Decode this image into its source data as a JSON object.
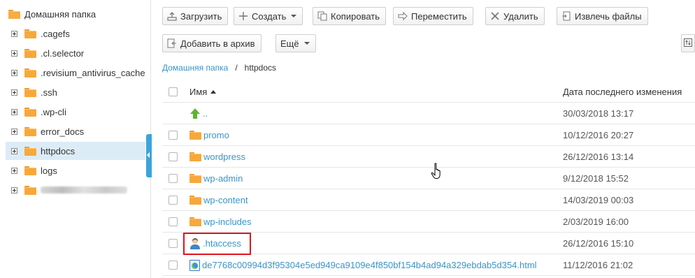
{
  "sidebar": {
    "root_label": "Домашняя папка",
    "items": [
      {
        "label": ".cagefs"
      },
      {
        "label": ".cl.selector"
      },
      {
        "label": ".revisium_antivirus_cache"
      },
      {
        "label": ".ssh"
      },
      {
        "label": ".wp-cli"
      },
      {
        "label": "error_docs"
      },
      {
        "label": "httpdocs",
        "selected": true
      },
      {
        "label": "logs"
      },
      {
        "label": ""
      }
    ]
  },
  "toolbar": {
    "upload": "Загрузить",
    "create": "Создать",
    "copy": "Копировать",
    "move": "Переместить",
    "delete": "Удалить",
    "extract": "Извлечь файлы",
    "archive": "Добавить в архив",
    "more": "Ещё"
  },
  "breadcrumb": {
    "home": "Домашняя папка",
    "separator": "/",
    "current": "httpdocs"
  },
  "table": {
    "col_name": "Имя",
    "col_date": "Дата последнего изменения",
    "rows": [
      {
        "name": "..",
        "date": "30/03/2018 13:17",
        "icon": "parent-dir-icon"
      },
      {
        "name": "promo",
        "date": "10/12/2016 20:27",
        "icon": "folder-icon"
      },
      {
        "name": "wordpress",
        "date": "26/12/2016 13:14",
        "icon": "folder-icon"
      },
      {
        "name": "wp-admin",
        "date": "9/12/2018 15:52",
        "icon": "folder-icon"
      },
      {
        "name": "wp-content",
        "date": "14/03/2019 00:03",
        "icon": "folder-icon"
      },
      {
        "name": "wp-includes",
        "date": "2/03/2019 16:00",
        "icon": "folder-icon"
      },
      {
        "name": ".htaccess",
        "date": "26/12/2016 15:10",
        "icon": "user-file-icon",
        "highlighted": true
      },
      {
        "name": "de7768c00994d3f95304e5ed949ca9109e4f850bf154b4ad94a329ebdab5d354.html",
        "date": "11/12/2016 21:02",
        "icon": "html-file-icon"
      }
    ]
  },
  "colors": {
    "link": "#3a95c9",
    "selected_bg": "#dcecf7",
    "highlight": "#e0141e",
    "folder": "#f7a83b"
  }
}
